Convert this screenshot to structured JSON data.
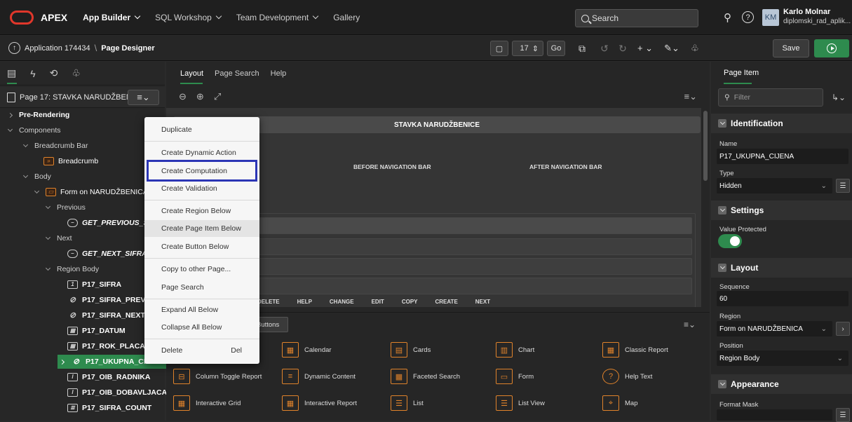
{
  "topbar": {
    "brand": "APEX",
    "nav": [
      "App Builder",
      "SQL Workshop",
      "Team Development",
      "Gallery"
    ],
    "search_placeholder": "Search",
    "user_initials": "KM",
    "user_name": "Karlo Molnar",
    "user_app": "diplomski_rad_aplik..."
  },
  "toolbar": {
    "breadcrumb_app": "Application 174434",
    "breadcrumb_page": "Page Designer",
    "page_number": "17",
    "go": "Go",
    "save": "Save"
  },
  "left": {
    "page_title": "Page 17: STAVKA NARUDŽBENICE",
    "tree": {
      "prerendering": "Pre-Rendering",
      "components": "Components",
      "breadcrumb_bar": "Breadcrumb Bar",
      "breadcrumb": "Breadcrumb",
      "body": "Body",
      "form": "Form on NARUDŽBENICA",
      "previous": "Previous",
      "get_prev": "GET_PREVIOUS_SIFR",
      "next": "Next",
      "get_next": "GET_NEXT_SIFRA",
      "region_body": "Region Body",
      "items": [
        "P17_SIFRA",
        "P17_SIFRA_PREV",
        "P17_SIFRA_NEXT",
        "P17_DATUM",
        "P17_ROK_PLACANJA",
        "P17_UKUPNA_CIJENA",
        "P17_OIB_RADNIKA",
        "P17_OIB_DOBAVLJACA",
        "P17_SIFRA_COUNT"
      ]
    }
  },
  "center": {
    "tabs": [
      "Layout",
      "Page Search",
      "Help"
    ],
    "region_title": "STAVKA NARUDŽBENICE",
    "before_nav": "BEFORE NAVIGATION BAR",
    "after_nav": "AFTER NAVIGATION BAR",
    "buttons": [
      "DELETE",
      "HELP",
      "CHANGE",
      "EDIT",
      "COPY",
      "CREATE",
      "NEXT"
    ],
    "gallery_tab": "Buttons",
    "gallery": [
      "Calendar",
      "Cards",
      "Chart",
      "Classic Report",
      "Column Toggle Report",
      "Dynamic Content",
      "Faceted Search",
      "Form",
      "Help Text",
      "Interactive Grid",
      "Interactive Report",
      "List",
      "List View",
      "Map"
    ]
  },
  "menu": {
    "items": [
      "Duplicate",
      "Create Dynamic Action",
      "Create Computation",
      "Create Validation",
      "Create Region Below",
      "Create Page Item Below",
      "Create Button Below",
      "Copy to other Page...",
      "Page Search",
      "Expand All Below",
      "Collapse All Below",
      "Delete"
    ],
    "delete_shortcut": "Del",
    "highlighted": "Create Computation"
  },
  "right": {
    "tab": "Page Item",
    "filter_placeholder": "Filter",
    "identification": "Identification",
    "name_label": "Name",
    "name_value": "P17_UKUPNA_CIJENA",
    "type_label": "Type",
    "type_value": "Hidden",
    "settings": "Settings",
    "value_protected": "Value Protected",
    "layout": "Layout",
    "sequence_label": "Sequence",
    "sequence_value": "60",
    "region_label": "Region",
    "region_value": "Form on NARUDŽBENICA",
    "position_label": "Position",
    "position_value": "Region Body",
    "appearance": "Appearance",
    "format_mask": "Format Mask"
  },
  "colors": {
    "accent_green": "#2e8b4e",
    "orange": "#e0832b",
    "highlight_box": "#2b35b5",
    "apex_red": "#e0372b"
  }
}
